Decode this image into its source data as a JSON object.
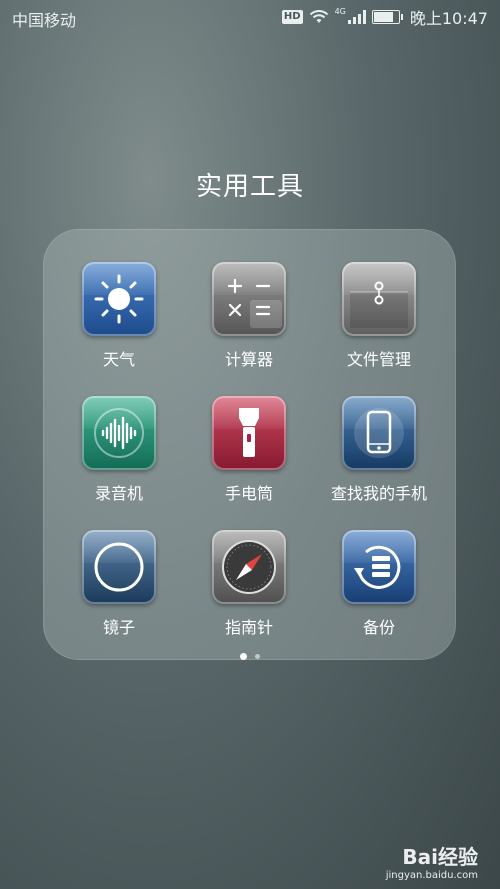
{
  "status_bar": {
    "carrier": "中国移动",
    "hd_badge": "HD",
    "network_type": "4G",
    "time": "晚上10:47",
    "battery_level": 0.72
  },
  "folder": {
    "title": "实用工具",
    "apps": [
      {
        "label": "天气",
        "icon": "weather-sun-icon"
      },
      {
        "label": "计算器",
        "icon": "calculator-icon"
      },
      {
        "label": "文件管理",
        "icon": "file-manager-icon"
      },
      {
        "label": "录音机",
        "icon": "voice-recorder-icon"
      },
      {
        "label": "手电筒",
        "icon": "flashlight-icon"
      },
      {
        "label": "查找我的手机",
        "icon": "find-my-phone-icon"
      },
      {
        "label": "镜子",
        "icon": "mirror-icon"
      },
      {
        "label": "指南针",
        "icon": "compass-icon"
      },
      {
        "label": "备份",
        "icon": "backup-icon"
      }
    ],
    "page_count": 2,
    "current_page": 1
  },
  "watermark": {
    "brand": "Bai经验",
    "site": "jingyan.baidu.com"
  },
  "colors": {
    "weather": "#2c5fa8",
    "calculator": "#6e6e6e",
    "file_manager": "#7a7a7a",
    "recorder": "#1f8f76",
    "flashlight": "#a8243e",
    "find_phone": "#24507f",
    "mirror": "#2a4f72",
    "compass": "#6a6a6a",
    "backup": "#24508a"
  }
}
